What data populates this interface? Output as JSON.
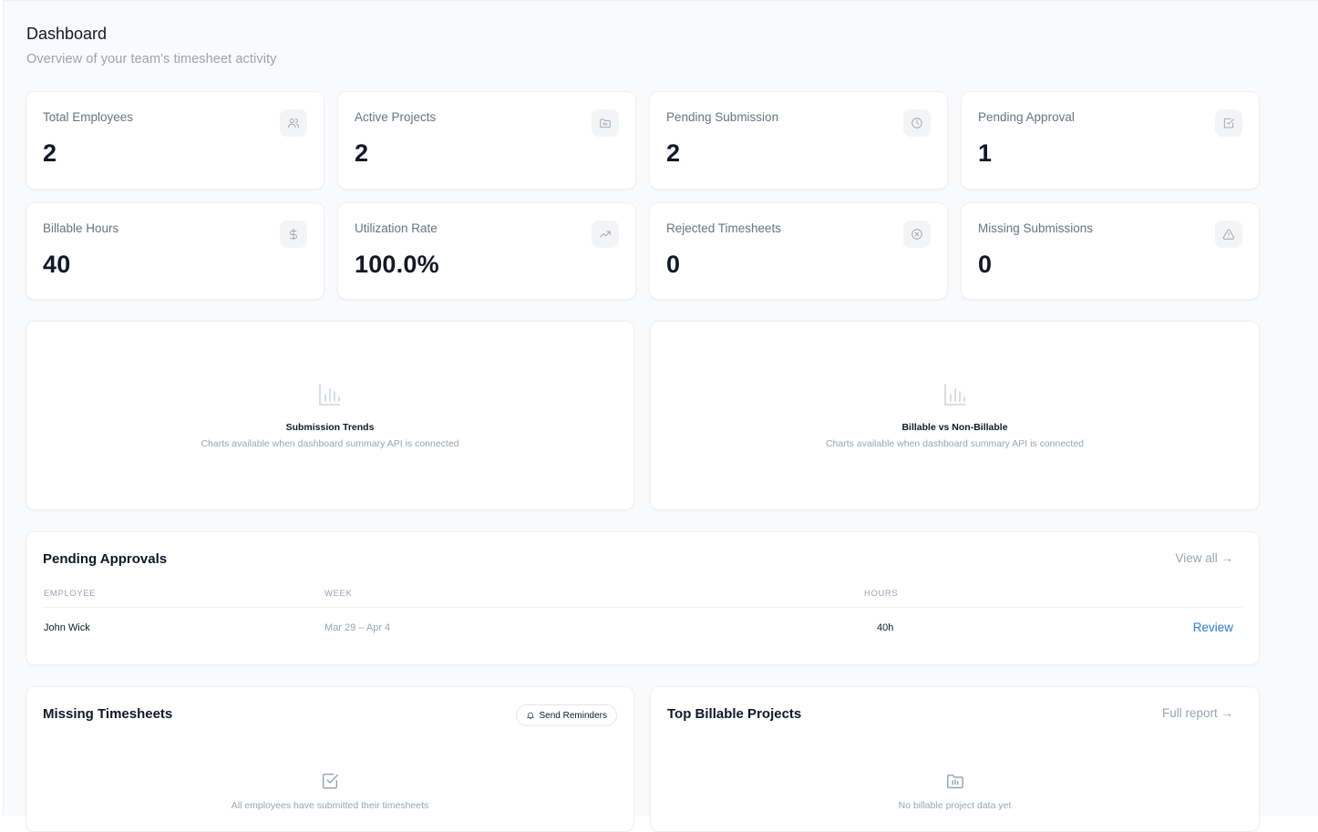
{
  "header": {
    "title": "Dashboard",
    "subtitle": "Overview of your team's timesheet activity"
  },
  "stats": [
    {
      "label": "Total Employees",
      "value": "2",
      "icon": "users-icon"
    },
    {
      "label": "Active Projects",
      "value": "2",
      "icon": "folder-icon"
    },
    {
      "label": "Pending Submission",
      "value": "2",
      "icon": "clock-icon"
    },
    {
      "label": "Pending Approval",
      "value": "1",
      "icon": "check-square-icon"
    },
    {
      "label": "Billable Hours",
      "value": "40",
      "icon": "dollar-icon"
    },
    {
      "label": "Utilization Rate",
      "value": "100.0%",
      "icon": "trending-up-icon"
    },
    {
      "label": "Rejected Timesheets",
      "value": "0",
      "icon": "x-circle-icon"
    },
    {
      "label": "Missing Submissions",
      "value": "0",
      "icon": "alert-triangle-icon"
    }
  ],
  "charts": [
    {
      "title": "Submission Trends",
      "message": "Charts available when dashboard summary API is connected",
      "icon": "bar-chart-icon"
    },
    {
      "title": "Billable vs Non-Billable",
      "message": "Charts available when dashboard summary API is connected",
      "icon": "bar-chart-icon"
    }
  ],
  "pending_approvals": {
    "title": "Pending Approvals",
    "view_all": "View all →",
    "columns": [
      "Employee",
      "Week",
      "Hours"
    ],
    "rows": [
      {
        "employee": "John Wick",
        "week": "Mar 29 – Apr 4",
        "hours": "40h",
        "action": "Review"
      }
    ]
  },
  "missing_timesheets": {
    "title": "Missing Timesheets",
    "button": "Send Reminders",
    "empty": "All employees have submitted their timesheets"
  },
  "top_billable": {
    "title": "Top Billable Projects",
    "link": "Full report →",
    "empty": "No billable project data yet"
  },
  "colors": {
    "background": "#f9fafb",
    "card": "#ffffff",
    "text": "#111827",
    "muted": "#9ca3af",
    "link": "#2f7bd6"
  }
}
